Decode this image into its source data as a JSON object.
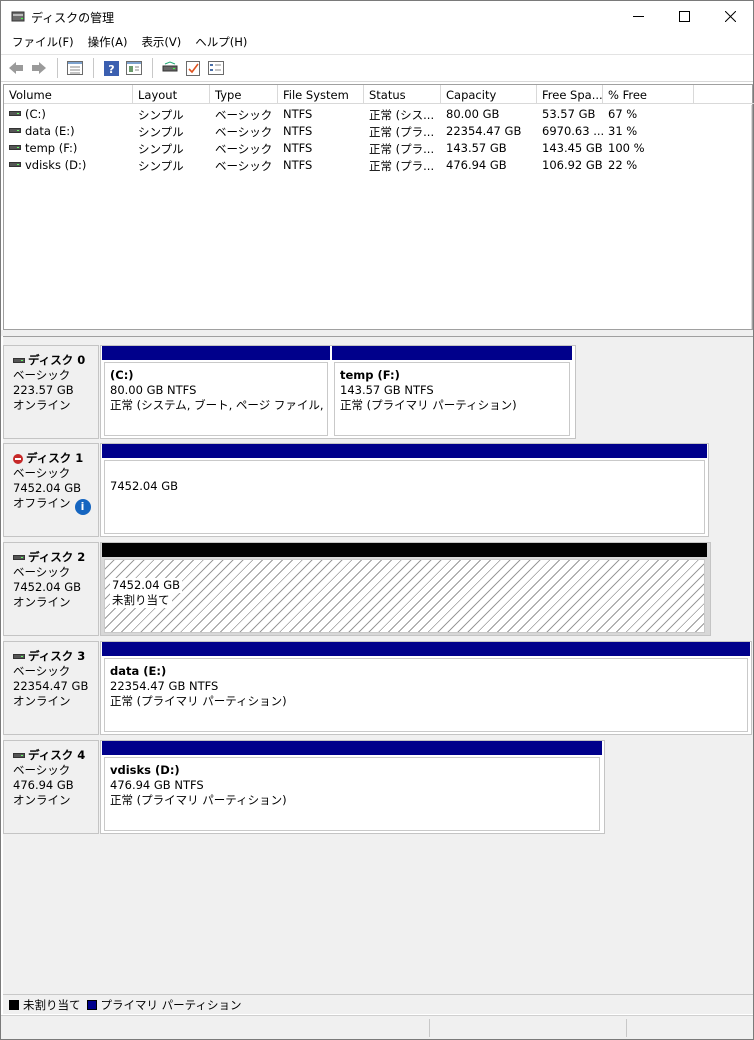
{
  "window": {
    "title": "ディスクの管理"
  },
  "window_controls": {
    "minimize": "—",
    "maximize": "☐",
    "close": "✕"
  },
  "menu": [
    {
      "label": "ファイル(F)"
    },
    {
      "label": "操作(A)"
    },
    {
      "label": "表示(V)"
    },
    {
      "label": "ヘルプ(H)"
    }
  ],
  "toolbar": {
    "icons": [
      "back-icon",
      "forward-icon",
      "disk-list-icon",
      "help-icon",
      "properties-icon",
      "rescan-icon",
      "check-icon",
      "settings-icon"
    ]
  },
  "volume_list": {
    "columns": [
      "Volume",
      "Layout",
      "Type",
      "File System",
      "Status",
      "Capacity",
      "Free Spa...",
      "% Free"
    ],
    "rows": [
      {
        "volume": "(C:)",
        "layout": "シンプル",
        "type": "ベーシック",
        "fs": "NTFS",
        "status": "正常 (シス...",
        "capacity": "80.00 GB",
        "free": "53.57 GB",
        "pct": "67 %"
      },
      {
        "volume": "data (E:)",
        "layout": "シンプル",
        "type": "ベーシック",
        "fs": "NTFS",
        "status": "正常 (プラ...",
        "capacity": "22354.47 GB",
        "free": "6970.63 ...",
        "pct": "31 %"
      },
      {
        "volume": "temp (F:)",
        "layout": "シンプル",
        "type": "ベーシック",
        "fs": "NTFS",
        "status": "正常 (プラ...",
        "capacity": "143.57 GB",
        "free": "143.45 GB",
        "pct": "100 %"
      },
      {
        "volume": "vdisks (D:)",
        "layout": "シンプル",
        "type": "ベーシック",
        "fs": "NTFS",
        "status": "正常 (プラ...",
        "capacity": "476.94 GB",
        "free": "106.92 GB",
        "pct": "22 %"
      }
    ]
  },
  "disks": [
    {
      "name": "ディスク 0",
      "type": "ベーシック",
      "size": "223.57 GB",
      "state": "オンライン",
      "partitions": [
        {
          "title": "(C:)",
          "line1": "80.00 GB NTFS",
          "line2": "正常 (システム, ブート, ページ ファイル, アクティブ"
        },
        {
          "title": "temp  (F:)",
          "line1": "143.57 GB NTFS",
          "line2": "正常 (プライマリ パーティション)"
        }
      ]
    },
    {
      "name": "ディスク 1",
      "type": "ベーシック",
      "size": "7452.04 GB",
      "state": "オフライン",
      "partitions": [
        {
          "title": "",
          "line1": "7452.04 GB",
          "line2": ""
        }
      ]
    },
    {
      "name": "ディスク 2",
      "type": "ベーシック",
      "size": "7452.04 GB",
      "state": "オンライン",
      "partitions": [
        {
          "title": "",
          "line1": "7452.04 GB",
          "line2": "未割り当て"
        }
      ]
    },
    {
      "name": "ディスク 3",
      "type": "ベーシック",
      "size": "22354.47 GB",
      "state": "オンライン",
      "partitions": [
        {
          "title": "data  (E:)",
          "line1": "22354.47 GB NTFS",
          "line2": "正常 (プライマリ パーティション)"
        }
      ]
    },
    {
      "name": "ディスク 4",
      "type": "ベーシック",
      "size": "476.94 GB",
      "state": "オンライン",
      "partitions": [
        {
          "title": "vdisks  (D:)",
          "line1": "476.94 GB NTFS",
          "line2": "正常 (プライマリ パーティション)"
        }
      ]
    }
  ],
  "legend": [
    {
      "label": "未割り当て",
      "color": "#000000"
    },
    {
      "label": "プライマリ パーティション",
      "color": "#00008b"
    }
  ],
  "colors": {
    "primary_partition": "#00008b",
    "unallocated": "#000000"
  }
}
